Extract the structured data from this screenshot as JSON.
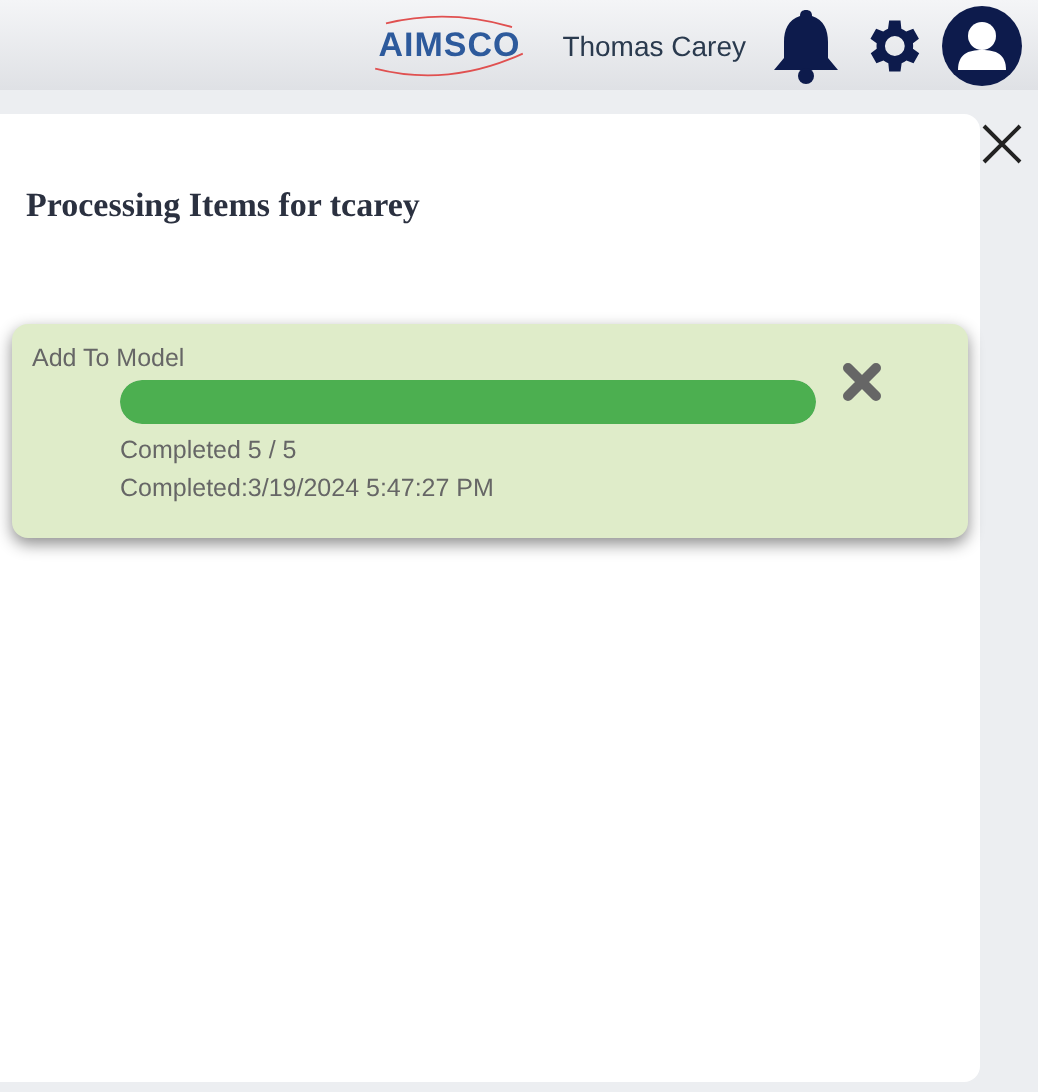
{
  "header": {
    "logo": "AIMSCO",
    "user_name": "Thomas Carey"
  },
  "panel": {
    "title": "Processing Items for tcarey"
  },
  "jobs": [
    {
      "name": "Add To Model",
      "level": 1,
      "count": "Completed 5 / 5",
      "completed_at": "Completed:3/19/2024 5:47:27 PM"
    }
  ]
}
